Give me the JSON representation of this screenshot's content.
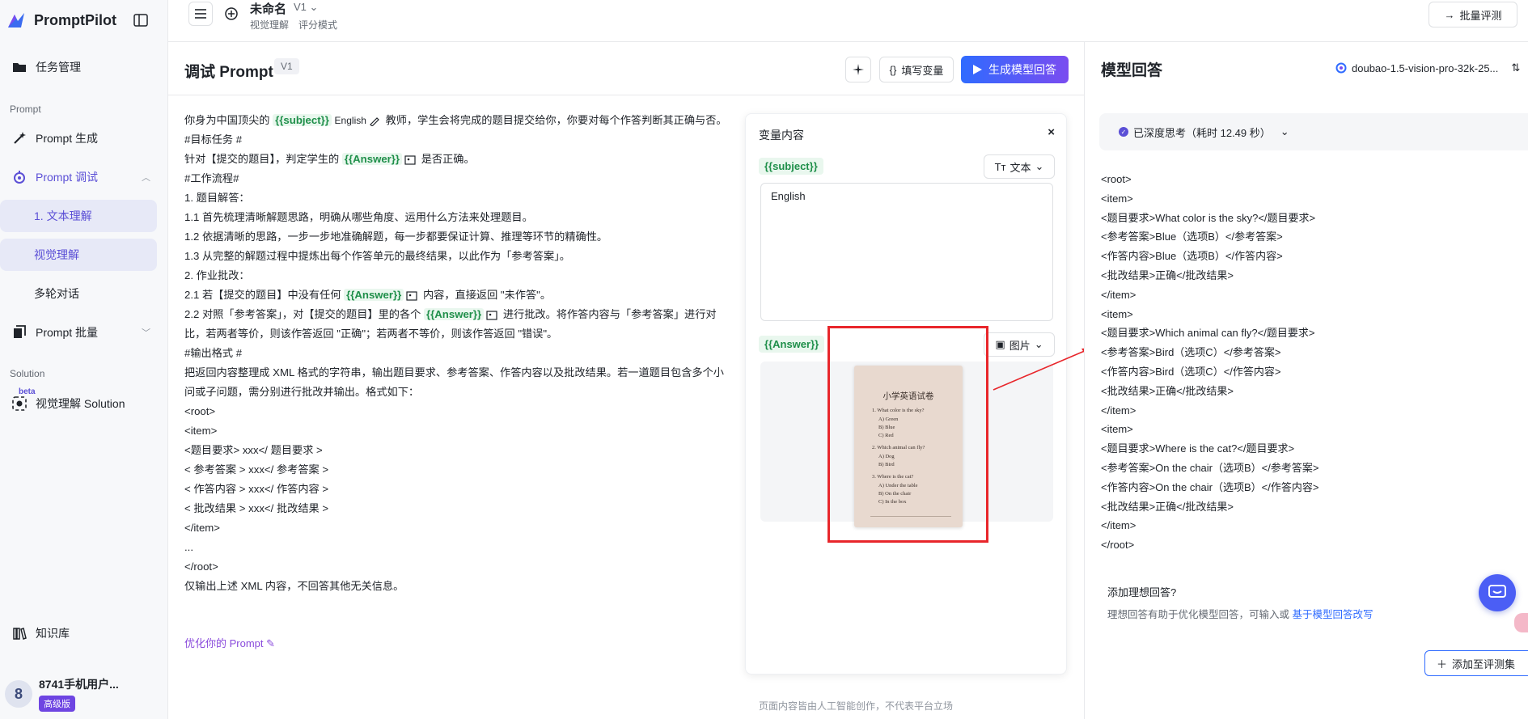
{
  "app": {
    "name": "PromptPilot"
  },
  "sidebar": {
    "task_mgmt": "任务管理",
    "section_prompt": "Prompt",
    "prompt_gen": "Prompt 生成",
    "prompt_debug": "Prompt 调试",
    "sub_text": "1. 文本理解",
    "sub_visual": "视觉理解",
    "sub_multi": "多轮对话",
    "prompt_batch": "Prompt 批量",
    "section_solution": "Solution",
    "beta": "beta",
    "visual_solution": "视觉理解 Solution",
    "knowledge": "知识库",
    "user": {
      "avatar": "8",
      "name": "8741手机用户...",
      "badge": "高级版"
    }
  },
  "topbar": {
    "doc_title": "未命名",
    "doc_version": "V1 ⌄",
    "tags": [
      "视觉理解",
      "评分模式"
    ],
    "batch_eval": "批量评测"
  },
  "main": {
    "title": "调试 Prompt",
    "version": "V1",
    "fill_vars": "填写变量",
    "generate": "生成模型回答",
    "optimize": "优化你的 Prompt"
  },
  "prompt": {
    "l1_a": "你身为中国顶尖的",
    "var_subject": "{{subject}}",
    "subject_value": "English",
    "l1_b": "教师，学生会将完成的题目提交给你，你要对每个作答判断其正确与否。",
    "l2": "#目标任务 #",
    "l3_a": "针对【提交的题目】，判定学生的",
    "var_answer": "{{Answer}}",
    "l3_b": "是否正确。",
    "l4": "#工作流程#",
    "l5": "1. 题目解答：",
    "l6": "1.1 首先梳理清晰解题思路，明确从哪些角度、运用什么方法来处理题目。",
    "l7": "1.2 依据清晰的思路，一步一步地准确解题，每一步都要保证计算、推理等环节的精确性。",
    "l8": "1.3 从完整的解题过程中提炼出每个作答单元的最终结果，以此作为「参考答案」。",
    "l9": "2. 作业批改：",
    "l10_a": "2.1 若【提交的题目】中没有任何",
    "l10_b": "内容，直接返回 \"未作答\"。",
    "l11_a": "2.2 对照「参考答案」，对【提交的题目】里的各个",
    "l11_b": "进行批改。将作答内容与「参考答案」进行对比，若两者等价，则该作答返回 \"正确\"；若两者不等价，则该作答返回 \"错误\"。",
    "l12": "#输出格式 #",
    "l13": "把返回内容整理成 XML 格式的字符串，输出题目要求、参考答案、作答内容以及批改结果。若一道题目包含多个小问或子问题，需分别进行批改并输出。格式如下：",
    "l14": "<root>",
    "l15": "<item>",
    "l16": "<题目要求> xxx</ 题目要求 >",
    "l17": "< 参考答案 > xxx</ 参考答案 >",
    "l18": "< 作答内容 > xxx</ 作答内容 >",
    "l19": "< 批改结果 > xxx</ 批改结果 >",
    "l20": "</item>",
    "l21": "...",
    "l22": "</root>",
    "l23": "仅输出上述 XML 内容，不回答其他无关信息。"
  },
  "var_panel": {
    "title": "变量内容",
    "close": "×",
    "subject_chip": "{{subject}}",
    "subject_type": "文本",
    "subject_value": "English",
    "answer_chip": "{{Answer}}",
    "answer_type": "图片",
    "worksheet": {
      "title": "小学英语试卷",
      "lines": [
        "1.  What color is the sky?",
        "A)  Green",
        "B)  Blue",
        "C)  Red",
        "2.  Which animal can fly?",
        "A)  Dog",
        "B)  Bird",
        "3.  Where is the cat?",
        "A)  Under the table",
        "B)  On the chair",
        "C)  In the box"
      ]
    }
  },
  "right": {
    "title": "模型回答",
    "model": "doubao-1.5-vision-pro-32k-25...",
    "thinking": "已深度思考（耗时 12.49 秒）",
    "answer_lines": [
      "<root>",
      "<item>",
      "<题目要求>What color is the sky?</题目要求>",
      "<参考答案>Blue（选项B）</参考答案>",
      "<作答内容>Blue（选项B）</作答内容>",
      "<批改结果>正确</批改结果>",
      "</item>",
      "<item>",
      "<题目要求>Which animal can fly?</题目要求>",
      "<参考答案>Bird（选项C）</参考答案>",
      "<作答内容>Bird（选项C）</作答内容>",
      "<批改结果>正确</批改结果>",
      "</item>",
      "<item>",
      "<题目要求>Where is the cat?</题目要求>",
      "<参考答案>On the chair（选项B）</参考答案>",
      "<作答内容>On the chair（选项B）</作答内容>",
      "<批改结果>正确</批改结果>",
      "</item>",
      "</root>"
    ],
    "ideal_title": "添加理想回答?",
    "ideal_desc": "理想回答有助于优化模型回答，可输入或",
    "ideal_link": "基于模型回答改写",
    "add_to_eval": "添加至评测集"
  },
  "footer": "页面内容皆由人工智能创作，不代表平台立场",
  "colors": {
    "accent": "#5b4fd6",
    "primary": "#2f6bff",
    "var_green": "#1f8f4a",
    "highlight_red": "#e8262b"
  }
}
